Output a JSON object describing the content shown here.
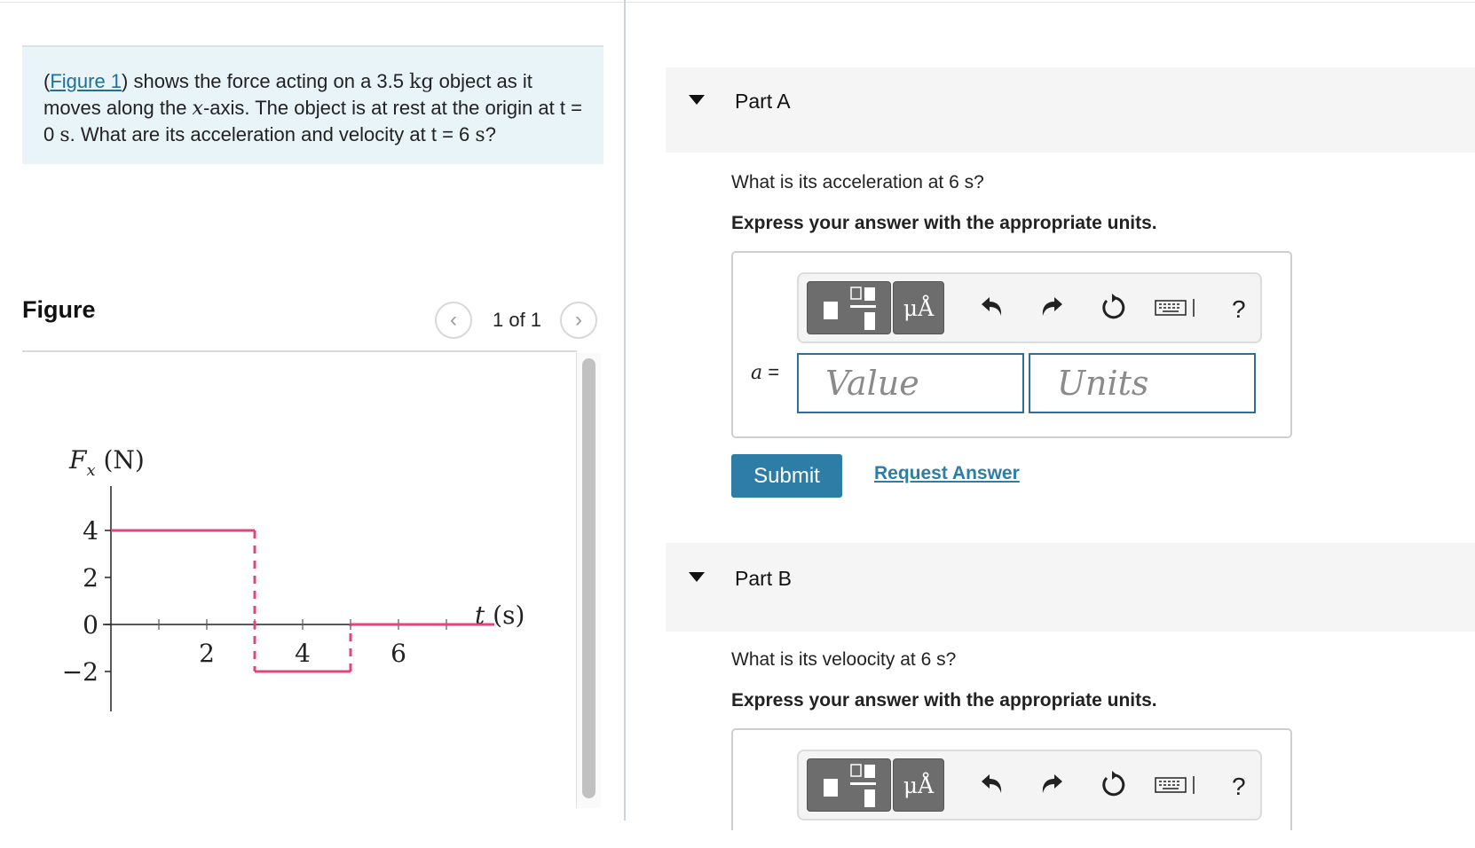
{
  "problem": {
    "figure_link": "Figure 1",
    "text_1": ") shows the force acting on a 3.5 ",
    "mass_unit": "kg",
    "text_2": " object as it moves along the ",
    "axis_symbol": "x",
    "text_3": "-axis. The object is at rest at the origin at t = 0 ",
    "t0_unit": "s",
    "text_4": ". What are its acceleration and velocity at t = 6 ",
    "t6_unit": "s",
    "text_5": "?"
  },
  "figure": {
    "title": "Figure",
    "pager": "1 of 1",
    "prev_icon": "chevron-left-icon",
    "next_icon": "chevron-right-icon"
  },
  "chart_data": {
    "type": "line",
    "ylabel": "Fx (N)",
    "xlabel": "t (s)",
    "x_ticks": [
      "2",
      "4",
      "6"
    ],
    "y_ticks": [
      "4",
      "2",
      "0",
      "−2"
    ],
    "xlim": [
      0,
      8
    ],
    "ylim": [
      -2,
      4
    ],
    "series": [
      {
        "x": [
          0,
          3,
          3,
          5,
          5,
          8
        ],
        "y": [
          4,
          4,
          -2,
          -2,
          0,
          0
        ],
        "color": "#e0457b"
      }
    ]
  },
  "partA": {
    "title": "Part A",
    "question": "What is its acceleration at 6 s?",
    "instruction": "Express your answer with the appropriate units.",
    "var": "a",
    "eq": " =",
    "value_placeholder": "Value",
    "units_placeholder": "Units",
    "mu_label": "μÅ",
    "help": "?",
    "submit": "Submit",
    "request": "Request Answer"
  },
  "partB": {
    "title": "Part B",
    "question": "What is its veloocity at 6 s?",
    "instruction": "Express your answer with the appropriate units.",
    "mu_label": "μÅ",
    "help": "?"
  },
  "colors": {
    "accent": "#2e7da6",
    "plot": "#e0457b",
    "problem_bg": "#e8f4f7"
  }
}
